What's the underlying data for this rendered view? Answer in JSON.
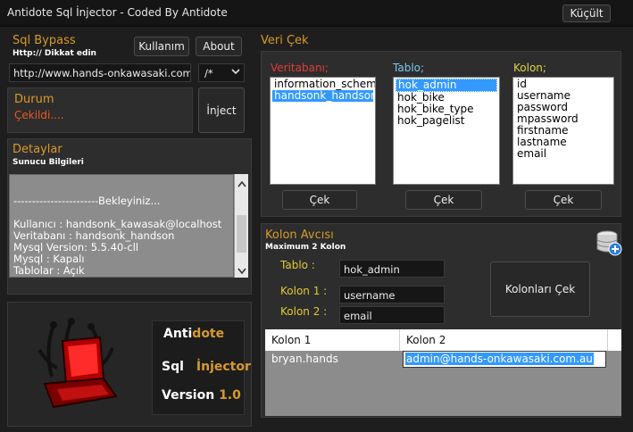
{
  "window": {
    "title": "Antidote Sql İnjector - Coded By Antidote",
    "minimize_label": "Küçült"
  },
  "bypass": {
    "title": "Sql Bypass",
    "hint": "Http:// Dikkat edin",
    "usage_btn": "Kullanım",
    "about_btn": "About",
    "url": "http://www.hands-onkawasaki.com.au/c",
    "comment": "/*"
  },
  "status": {
    "title": "Durum",
    "value": "Çekildi....",
    "inject_btn": "İnject"
  },
  "details": {
    "title": "Detaylar",
    "subtitle": "Sunucu Bilgileri",
    "lines": [
      "-----------------------Bekleyiniz...",
      "",
      "Kullanıcı : handsonk_kawasak@localhost",
      "Veritabanı : handsonk_handson",
      "Mysql Version: 5.5.40-cll",
      "Mysql : Kapalı",
      "Tablolar : Açık",
      "",
      "------------------------"
    ]
  },
  "logo": {
    "line1a": "Anti",
    "line1b": "dote",
    "line2a": "Sql",
    "line2b": "İnjector",
    "line3a": "Version",
    "line3b": "1.0"
  },
  "veri": {
    "title": "Veri Çek",
    "db_label": "Veritabanı;",
    "table_label": "Tablo;",
    "column_label": "Kolon;",
    "databases": [
      "information_schema",
      "handsonk_handson"
    ],
    "tables": [
      "hok_admin",
      "hok_bike",
      "hok_bike_type",
      "hok_pagelist"
    ],
    "columns": [
      "id",
      "username",
      "password",
      "mpassword",
      "firstname",
      "lastname",
      "email"
    ],
    "cek": "Çek"
  },
  "hunter": {
    "title": "Kolon Avcısı",
    "subtitle": "Maximum 2 Kolon",
    "table_label": "Tablo :",
    "table_value": "hok_admin",
    "col1_label": "Kolon 1 :",
    "col1_value": "username",
    "col2_label": "Kolon 2 :",
    "col2_value": "email",
    "fetch_btn": "Kolonları Çek",
    "head1": "Kolon 1",
    "head2": "Kolon 2",
    "row_c1": "bryan.hands",
    "row_c2": "admin@hands-onkawasaki.com.au"
  },
  "colors": {
    "accent": "#d89a2a",
    "red": "#e03b3b",
    "blue": "#7cc8ee",
    "yellow": "#e0d24a",
    "status": "#e85a20",
    "selection": "#3399ff"
  }
}
